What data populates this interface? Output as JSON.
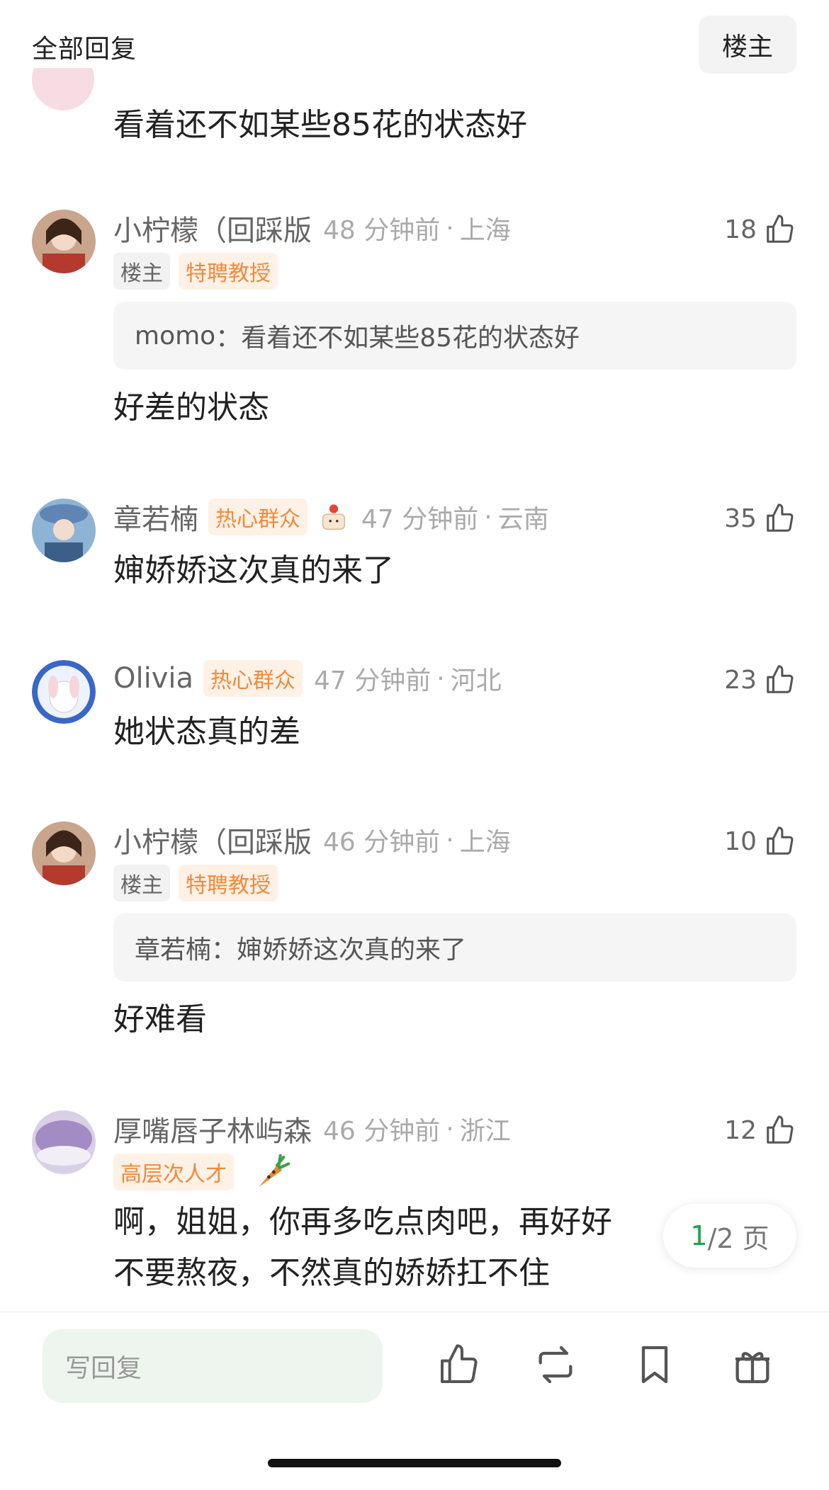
{
  "header": {
    "title": "全部回复",
    "op_button": "楼主"
  },
  "top_snippet": {
    "text": "看着还不如某些85花的状态好"
  },
  "comments": [
    {
      "username": "小柠檬（回踩版",
      "time": "48 分钟前",
      "location": "上海",
      "badges": [
        "楼主",
        "特聘教授"
      ],
      "likes": "18",
      "quote_author": "momo",
      "quote_text": "看着还不如某些85花的状态好",
      "text": "好差的状态"
    },
    {
      "username": "章若楠",
      "badge": "热心群众",
      "time": "47 分钟前",
      "location": "云南",
      "likes": "35",
      "text": "婶娇娇这次真的来了"
    },
    {
      "username": "Olivia",
      "badge": "热心群众",
      "time": "47 分钟前",
      "location": "河北",
      "likes": "23",
      "text": "她状态真的差"
    },
    {
      "username": "小柠檬（回踩版",
      "time": "46 分钟前",
      "location": "上海",
      "badges": [
        "楼主",
        "特聘教授"
      ],
      "likes": "10",
      "quote_author": "章若楠",
      "quote_text": "婶娇娇这次真的来了",
      "text": "好难看"
    },
    {
      "username": "厚嘴唇子林屿森",
      "time": "46 分钟前",
      "location": "浙江",
      "badge": "高层次人才",
      "likes": "12",
      "text_line1": "啊，姐姐，你再多吃点肉吧，再好好",
      "text_line2": "不要熬夜，不然真的娇娇扛不住"
    }
  ],
  "pagination": {
    "current": "1",
    "rest": "/2 页"
  },
  "bottom_bar": {
    "reply_placeholder": "写回复"
  },
  "icons": [
    "thumbs-up-icon",
    "repost-icon",
    "bookmark-icon",
    "gift-icon"
  ],
  "colors": {
    "badge_orange": "#f08a3c",
    "page_current": "#19a64a"
  }
}
